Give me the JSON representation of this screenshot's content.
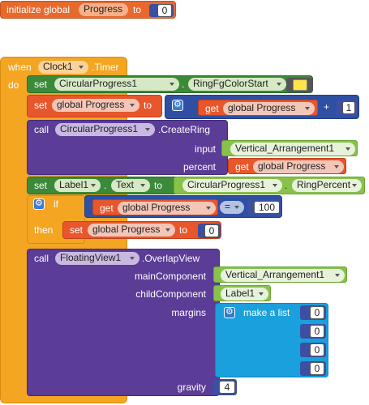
{
  "init_global": {
    "label": "initialize global",
    "var_name": "Progress",
    "to": "to",
    "value": "0"
  },
  "event": {
    "when": "when",
    "component": "Clock1",
    "event_name": ".Timer",
    "do": "do"
  },
  "set_ring_color": {
    "set": "set",
    "component": "CircularProgress1",
    "dot": ".",
    "property": "RingFgColorStart",
    "to": "to",
    "color": "#ffe347"
  },
  "set_progress": {
    "set": "set",
    "var": "global Progress",
    "to": "to",
    "get": "get",
    "get_var": "global Progress",
    "op": "+",
    "value": "1"
  },
  "create_ring": {
    "call": "call",
    "component": "CircularProgress1",
    "method": ".CreateRing",
    "input_label": "input",
    "input_value": "Vertical_Arrangement1",
    "percent_label": "percent",
    "get": "get",
    "percent_var": "global Progress"
  },
  "set_label": {
    "set": "set",
    "component": "Label1",
    "dot": ".",
    "property": "Text",
    "to": "to",
    "source_component": "CircularProgress1",
    "source_property": "RingPercent"
  },
  "if_block": {
    "if": "if",
    "get": "get",
    "var": "global Progress",
    "op": "=",
    "value": "100",
    "then": "then",
    "set": "set",
    "set_var": "global Progress",
    "to": "to",
    "set_value": "0"
  },
  "overlap_view": {
    "call": "call",
    "component": "FloatingView1",
    "method": ".OverlapView",
    "main_label": "mainComponent",
    "main_value": "Vertical_Arrangement1",
    "child_label": "childComponent",
    "child_value": "Label1",
    "margins_label": "margins",
    "make_list": "make a list",
    "list_values": [
      "0",
      "0",
      "0",
      "0"
    ],
    "gravity_label": "gravity",
    "gravity_value": "4"
  }
}
